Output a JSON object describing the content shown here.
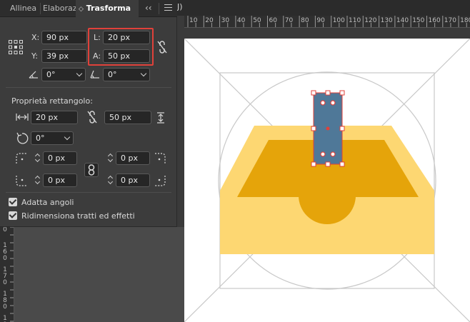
{
  "window": {
    "title_fragment": "J)"
  },
  "panel": {
    "tabs": [
      {
        "label": "Allinea",
        "active": false
      },
      {
        "label": "Elaborazi",
        "active": false
      },
      {
        "label": "Trasforma",
        "active": true
      }
    ],
    "collapse_icon": "double-chevron-left-icon",
    "menu_icon": "hamburger-menu-icon",
    "transform": {
      "x_label": "X:",
      "x_value": "90 px",
      "y_label": "Y:",
      "y_value": "39 px",
      "width_label": "L:",
      "width_value": "20 px",
      "height_label": "A:",
      "height_value": "50 px",
      "angle_value": "0°",
      "shear_value": "0°"
    },
    "rect_props": {
      "title": "Proprietà rettangolo:",
      "width_value": "20 px",
      "height_value": "50 px",
      "rotation_value": "0°",
      "corner_tl": "0 px",
      "corner_tr": "0 px",
      "corner_bl": "0 px",
      "corner_br": "0 px"
    },
    "checkboxes": {
      "scale_corners": {
        "label": "Adatta angoli",
        "checked": true
      },
      "scale_strokes": {
        "label": "Ridimensiona tratti ed effetti",
        "checked": true
      }
    }
  },
  "ruler_h": {
    "labels": [
      "10",
      "20",
      "30",
      "40",
      "50",
      "60",
      "70",
      "80",
      "90",
      "100",
      "110",
      "120",
      "130",
      "140",
      "150",
      "160",
      "170",
      "180"
    ]
  },
  "ruler_v": {
    "labels": [
      "0",
      "160",
      "170",
      "180",
      "190",
      "200"
    ]
  },
  "colors": {
    "highlight": "#e0413a",
    "tray_light": "#fdd772",
    "tray_dark": "#e5a40a",
    "selected_rect": "#4f7898",
    "guide": "#c8c8c8"
  }
}
